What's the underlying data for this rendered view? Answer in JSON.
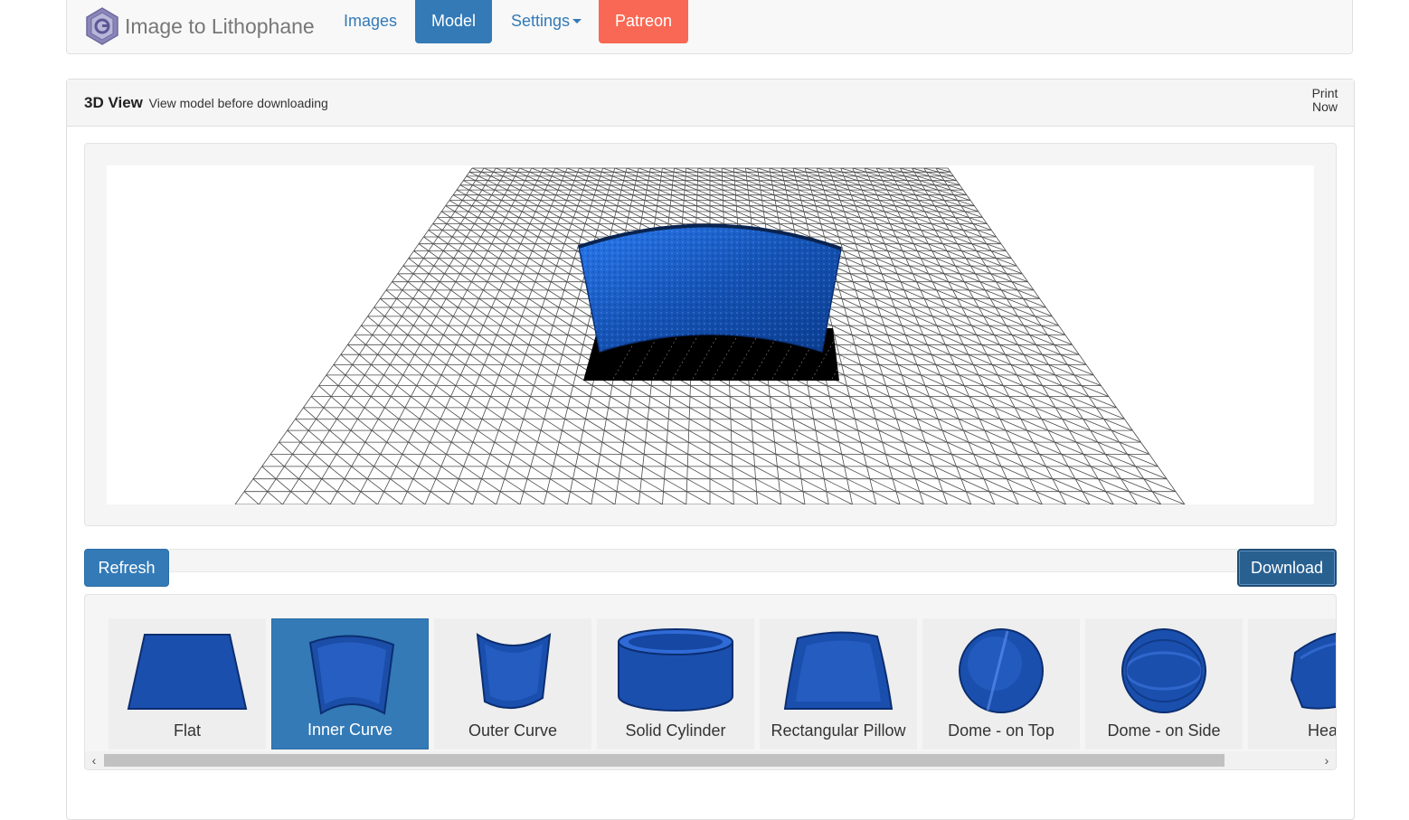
{
  "navbar": {
    "brand": "Image to Lithophane",
    "items": [
      {
        "label": "Images",
        "active": false
      },
      {
        "label": "Model",
        "active": true
      },
      {
        "label": "Settings",
        "active": false
      },
      {
        "label": "Patreon",
        "active": false
      }
    ]
  },
  "panel": {
    "title": "3D View",
    "subtitle": "View model before downloading",
    "print_line1": "Print",
    "print_line2": "Now"
  },
  "toolbar": {
    "refresh_label": "Refresh",
    "download_label": "Download",
    "progress_percent": 0
  },
  "shapes": {
    "items": [
      {
        "label": "Flat",
        "selected": false
      },
      {
        "label": "Inner Curve",
        "selected": true
      },
      {
        "label": "Outer Curve",
        "selected": false
      },
      {
        "label": "Solid Cylinder",
        "selected": false
      },
      {
        "label": "Rectangular Pillow",
        "selected": false
      },
      {
        "label": "Dome - on Top",
        "selected": false
      },
      {
        "label": "Dome - on Side",
        "selected": false
      },
      {
        "label": "Hea",
        "selected": false
      }
    ],
    "scroll_left_glyph": "‹",
    "scroll_right_glyph": "›"
  },
  "colors": {
    "primary": "#337ab7",
    "primary_dark": "#286090",
    "patreon": "#f96854",
    "model_blue": "#1553b5",
    "tile_bg": "#eeeeee"
  },
  "icons": [
    "logo-icon",
    "caret-down-icon",
    "chevron-left-icon",
    "chevron-right-icon"
  ]
}
